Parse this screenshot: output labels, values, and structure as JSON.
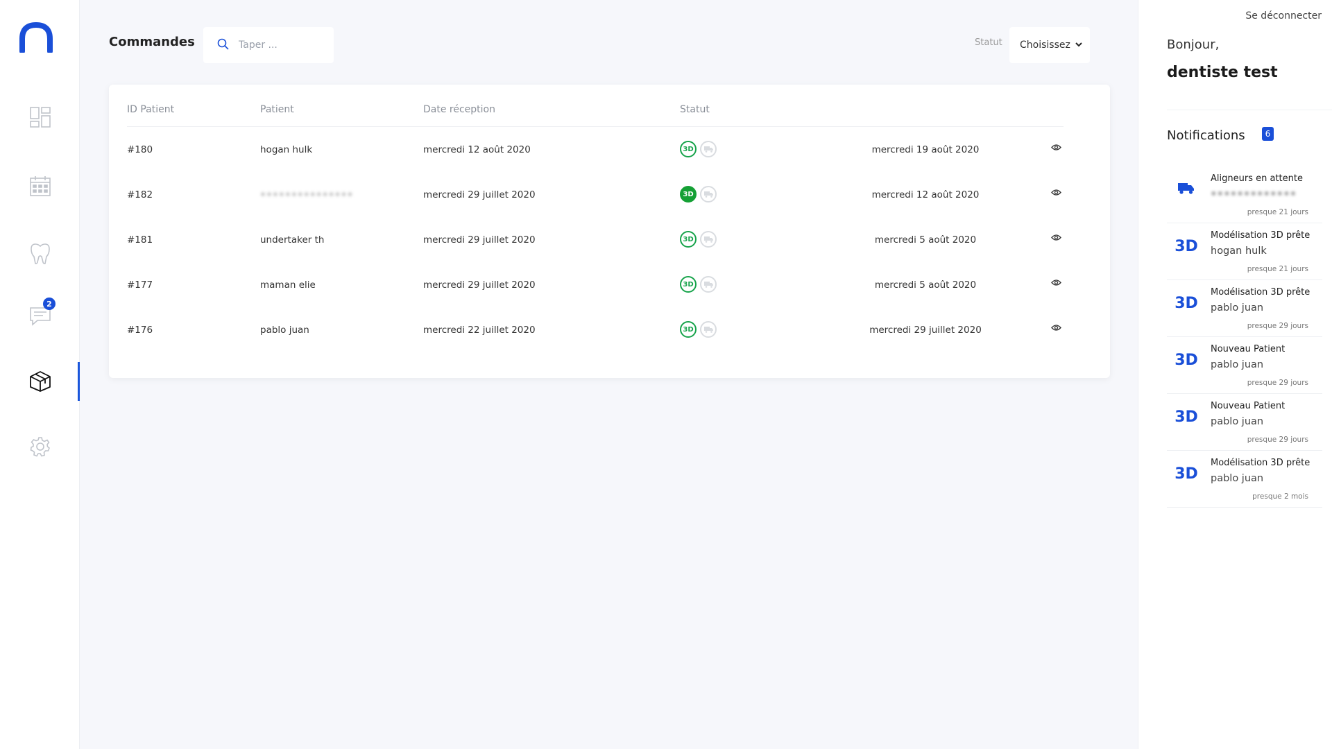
{
  "nav": {
    "items": [
      {
        "id": "dashboard",
        "icon": "dashboard-icon"
      },
      {
        "id": "calendar",
        "icon": "calendar-icon"
      },
      {
        "id": "patients",
        "icon": "tooth-icon"
      },
      {
        "id": "messages",
        "icon": "message-icon",
        "badge": "2"
      },
      {
        "id": "orders",
        "icon": "package-icon",
        "active": true
      },
      {
        "id": "settings",
        "icon": "gear-icon"
      }
    ]
  },
  "header": {
    "title": "Commandes",
    "search_placeholder": "Taper ...",
    "status_label": "Statut",
    "status_value": "Choisissez"
  },
  "table": {
    "columns": [
      "ID Patient",
      "Patient",
      "Date réception",
      "Statut"
    ],
    "rows": [
      {
        "id": "#180",
        "patient": "hogan hulk",
        "received": "mercredi 12 août 2020",
        "status_3d": "outline",
        "due": "mercredi 19 août 2020"
      },
      {
        "id": "#182",
        "patient": "•••••••••••••••",
        "patient_blurred": true,
        "received": "mercredi 29 juillet 2020",
        "status_3d": "filled",
        "due": "mercredi 12 août 2020"
      },
      {
        "id": "#181",
        "patient": "undertaker th",
        "received": "mercredi 29 juillet 2020",
        "status_3d": "outline",
        "due": "mercredi 5 août 2020"
      },
      {
        "id": "#177",
        "patient": "maman elie",
        "received": "mercredi 29 juillet 2020",
        "status_3d": "outline",
        "due": "mercredi 5 août 2020"
      },
      {
        "id": "#176",
        "patient": "pablo juan",
        "received": "mercredi 22 juillet 2020",
        "status_3d": "outline",
        "due": "mercredi 29 juillet 2020"
      }
    ],
    "status_3d_text": "3D"
  },
  "user": {
    "logout": "Se déconnecter",
    "greeting": "Bonjour,",
    "name": "dentiste test"
  },
  "notifications": {
    "title": "Notifications",
    "count": "6",
    "items": [
      {
        "icon": "truck-icon",
        "title": "Aligneurs en attente",
        "name": "•••••••••••••",
        "blurred": true,
        "time": "presque 21 jours"
      },
      {
        "icon": "3d",
        "title": "Modélisation 3D prête",
        "name": "hogan hulk",
        "time": "presque 21 jours"
      },
      {
        "icon": "3d",
        "title": "Modélisation 3D prête",
        "name": "pablo juan",
        "time": "presque 29 jours"
      },
      {
        "icon": "3d",
        "title": "Nouveau Patient",
        "name": "pablo juan",
        "time": "presque 29 jours"
      },
      {
        "icon": "3d",
        "title": "Nouveau Patient",
        "name": "pablo juan",
        "time": "presque 29 jours"
      },
      {
        "icon": "3d",
        "title": "Modélisation 3D prête",
        "name": "pablo juan",
        "time": "presque 2 mois"
      }
    ],
    "icon_3d_text": "3D"
  },
  "colors": {
    "accent": "#1a4fd8",
    "status_green": "#15a035",
    "background": "#f6f7fb"
  }
}
